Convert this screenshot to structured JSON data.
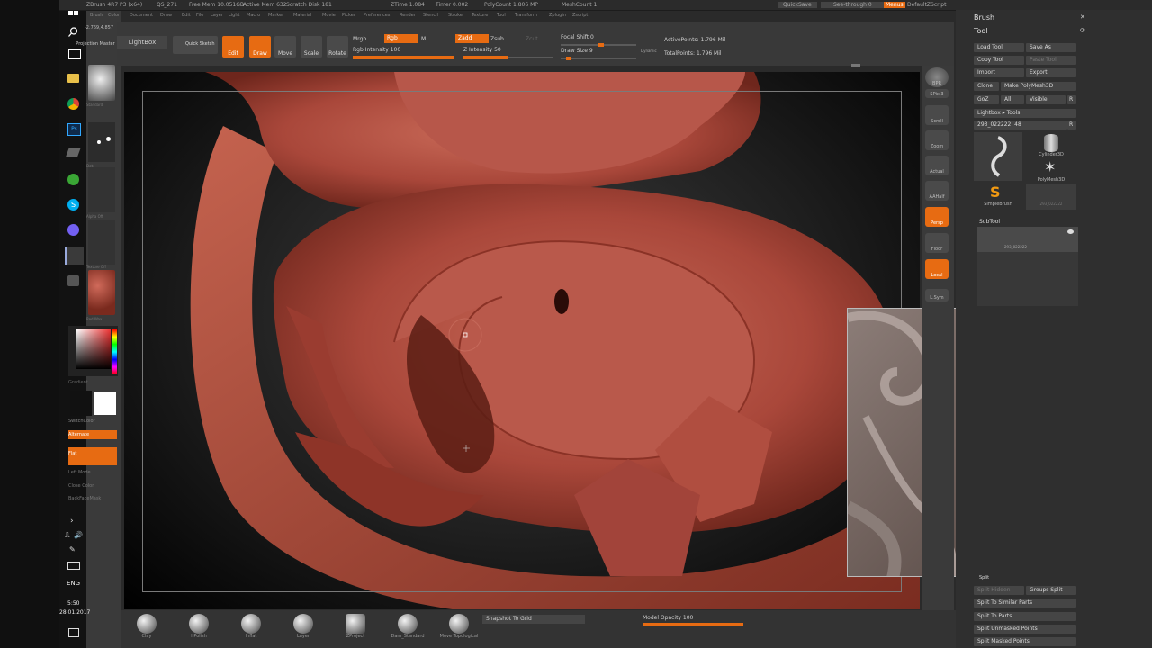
{
  "menubar": {
    "items": [
      "ZBrush",
      "Alpha",
      "Brush",
      "Color",
      "Document",
      "Draw",
      "Edit",
      "File",
      "Layer",
      "Light",
      "Macro",
      "Marker",
      "Material",
      "Movie",
      "Picker",
      "Preferences",
      "Render",
      "Stencil",
      "Stroke",
      "Texture",
      "Tool",
      "Transform",
      "Zplugin",
      "Zscript"
    ],
    "app_info": "ZBrush 4R7 P3 (x64)",
    "doc_name": "QS_271",
    "stats": [
      "Free Mem 10.051GB",
      "Active Mem 632",
      "Scratch Disk 181",
      "ZTime 1.084",
      "Timer 0.002",
      "PolyCount 1.806 MP",
      "MeshCount 1"
    ],
    "quicksave": "QuickSave",
    "see_through": "See-through  0",
    "menus": "Menus",
    "default_script": "DefaultZScript"
  },
  "toolbar": {
    "coords": "-2.769,4.857",
    "projection_master": "Projection Master",
    "lightbox": "LightBox",
    "quick_sketch": "Quick Sketch",
    "edit": "Edit",
    "draw": "Draw",
    "move": "Move",
    "scale": "Scale",
    "rotate": "Rotate",
    "mrgb": "Mrgb",
    "rgb": "Rgb",
    "m": "M",
    "rgb_intensity_label": "Rgb Intensity",
    "rgb_intensity_value": "100",
    "rgb_intensity_fraction": 1.0,
    "zadd": "Zadd",
    "zsub": "Zsub",
    "zcut": "Zcut",
    "z_intensity_label": "Z Intensity",
    "z_intensity_value": "50",
    "z_intensity_fraction": 0.5,
    "focal_shift_label": "Focal Shift",
    "focal_shift_value": "0",
    "draw_size_label": "Draw Size",
    "draw_size_value": "9",
    "dynamic": "Dynamic",
    "active_points": "ActivePoints: 1.796 Mil",
    "total_points": "TotalPoints: 1.796 Mil"
  },
  "taskbar": {
    "time": "5:50",
    "date": "28.01.2017",
    "lang": "ENG"
  },
  "leftstrip": {
    "labels": [
      "Gradient",
      "SwitchColor",
      "Alternate",
      "Flat",
      "Left Mode",
      "Close Color",
      "BackFaceMask"
    ],
    "brush_label": "Standard",
    "alpha_label": "Alpha Off",
    "stroke_label": "Dots",
    "texture_label": "Texture Off",
    "material_label": "Red Wax"
  },
  "rshelf": {
    "buttons": [
      "BPR",
      "SPix 3",
      "Scroll",
      "Zoom",
      "Actual",
      "AAHalf",
      "Persp",
      "Floor",
      "Local",
      "L.Sym"
    ]
  },
  "rpanel": {
    "brush_title": "Brush",
    "tool_title": "Tool",
    "load_tool": "Load Tool",
    "save_as": "Save As",
    "copy_tool": "Copy Tool",
    "paste_tool": "Paste Tool",
    "import": "Import",
    "export": "Export",
    "clone": "Clone",
    "make_polymesh": "Make PolyMesh3D",
    "goz": "GoZ",
    "all": "All",
    "visible": "Visible",
    "r": "R",
    "lightbox_tools": "Lightbox ▸ Tools",
    "current_tool": "293_022222. 48",
    "thumbs": [
      "293_022222",
      "Cylinder3D",
      "PolyMesh3D",
      "SimpleBrush",
      "293_022222"
    ],
    "subtool_title": "SubTool",
    "subtool_name": "293_022222",
    "split_title": "Split",
    "split_hidden": "Split Hidden",
    "groups_split": "Groups Split",
    "split_similar": "Split To Similar Parts",
    "split_parts": "Split To Parts",
    "split_unmasked": "Split Unmasked Points",
    "split_masked": "Split Masked Points"
  },
  "bshelf": {
    "brushes": [
      "Clay",
      "hPolish",
      "Inflat",
      "Layer",
      "ZProject",
      "Dam_Standard",
      "Move Topological"
    ],
    "snapshot": "Snapshot To Grid",
    "model_opacity_label": "Model Opacity",
    "model_opacity_value": "100",
    "model_opacity_fraction": 1.0
  },
  "colors": {
    "accent": "#e76b12",
    "clay": "#b5523f",
    "panel": "#393939"
  }
}
